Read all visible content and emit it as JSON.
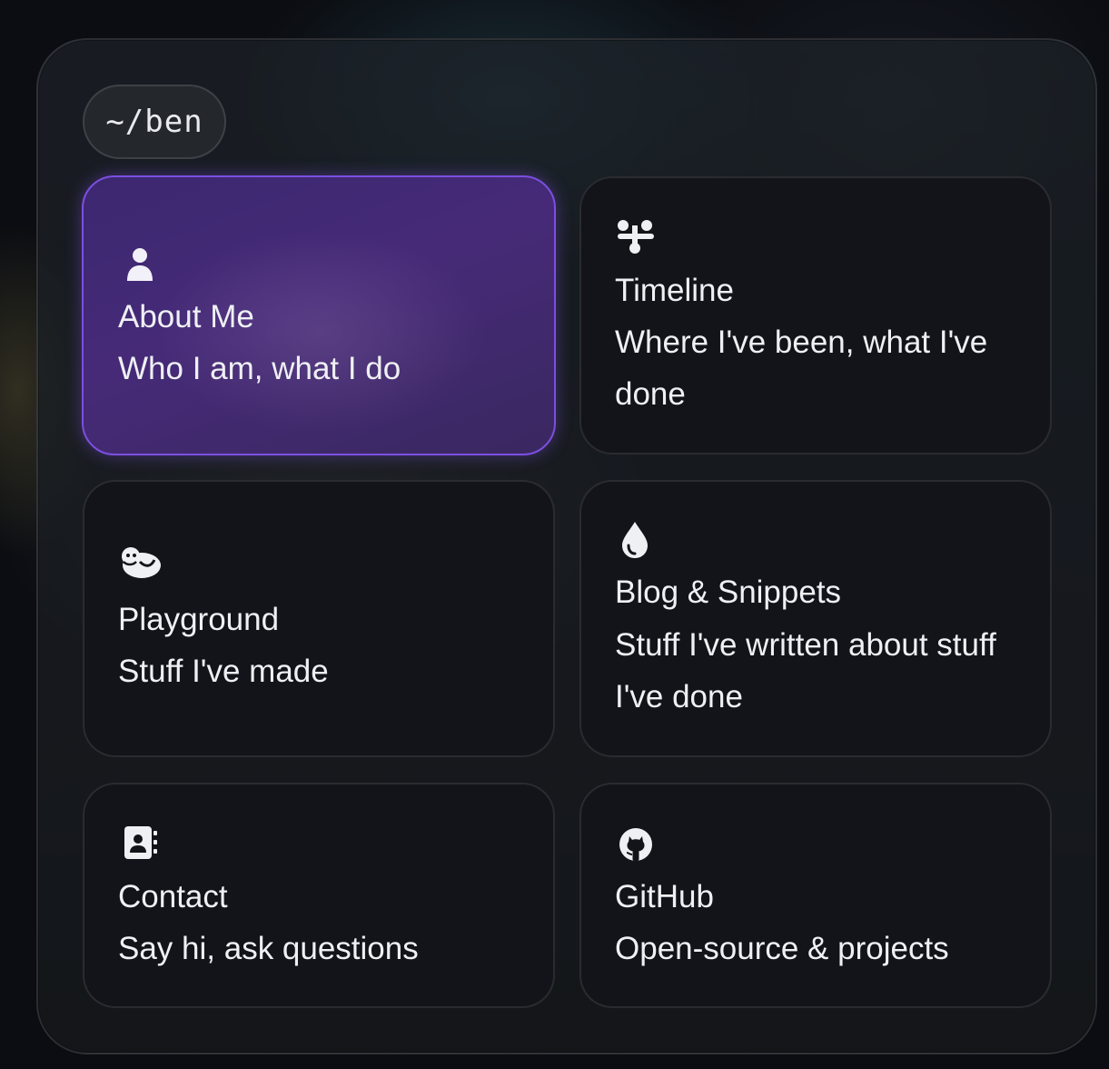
{
  "header": {
    "path": "~/ben"
  },
  "cards": [
    {
      "icon": "person-icon",
      "title": "About Me",
      "description": "Who I am, what I do",
      "active": true
    },
    {
      "icon": "timeline-icon",
      "title": "Timeline",
      "description": "Where I've been, what I've done",
      "active": false
    },
    {
      "icon": "otter-icon",
      "title": "Playground",
      "description": "Stuff I've made",
      "active": false
    },
    {
      "icon": "droplet-icon",
      "title": "Blog & Snippets",
      "description": "Stuff I've written about stuff I've done",
      "active": false
    },
    {
      "icon": "address-book-icon",
      "title": "Contact",
      "description": "Say hi, ask questions",
      "active": false
    },
    {
      "icon": "github-icon",
      "title": "GitHub",
      "description": "Open-source & projects",
      "active": false
    }
  ],
  "colors": {
    "accent": "#7c4fe0",
    "card_bg": "#121419",
    "text": "#eef0f4"
  }
}
